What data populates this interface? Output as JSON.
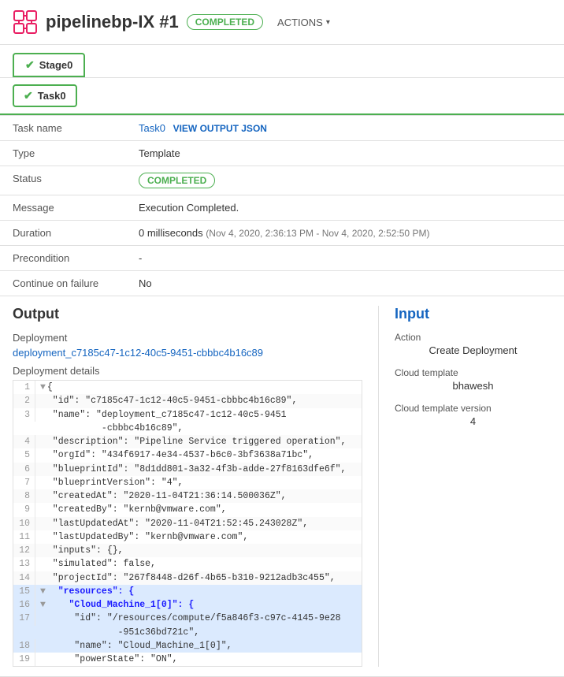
{
  "header": {
    "icon_alt": "pipeline-icon",
    "title": "pipelinebp-IX #1",
    "badge": "COMPLETED",
    "actions_label": "ACTIONS"
  },
  "stage": {
    "label": "Stage0",
    "check": "✔"
  },
  "task": {
    "label": "Task0",
    "check": "✔"
  },
  "info": {
    "task_name_label": "Task name",
    "task_name_value": "Task0",
    "view_output_label": "VIEW OUTPUT JSON",
    "type_label": "Type",
    "type_value": "Template",
    "status_label": "Status",
    "status_value": "COMPLETED",
    "message_label": "Message",
    "message_value": "Execution Completed.",
    "duration_label": "Duration",
    "duration_main": "0 milliseconds",
    "duration_detail": "(Nov 4, 2020, 2:36:13 PM - Nov 4, 2020, 2:52:50 PM)",
    "precondition_label": "Precondition",
    "precondition_value": "-",
    "continue_label": "Continue on failure",
    "continue_value": "No"
  },
  "output": {
    "title": "Output",
    "deployment_label": "Deployment",
    "deployment_link": "deployment_c7185c47-1c12-40c5-9451-cbbbc4b16c89",
    "details_label": "Deployment details",
    "code_lines": [
      {
        "num": "1",
        "arrow": "▼",
        "content": "{",
        "highlight": false
      },
      {
        "num": "2",
        "arrow": " ",
        "content": "  \"id\": \"c7185c47-1c12-40c5-9451-cbbbc4b16c89\",",
        "highlight": false
      },
      {
        "num": "3",
        "arrow": " ",
        "content": "  \"name\": \"deployment_c7185c47-1c12-40c5-9451\n             -cbbbc4b16c89\",",
        "highlight": false
      },
      {
        "num": "4",
        "arrow": " ",
        "content": "  \"description\": \"Pipeline Service triggered operation\",",
        "highlight": false
      },
      {
        "num": "5",
        "arrow": " ",
        "content": "  \"orgId\": \"434f6917-4e34-4537-b6c0-3bf3638a71bc\",",
        "highlight": false
      },
      {
        "num": "6",
        "arrow": " ",
        "content": "  \"blueprintId\": \"8d1dd801-3a32-4f3b-adde-27f8163dfe6f\",",
        "highlight": false
      },
      {
        "num": "7",
        "arrow": " ",
        "content": "  \"blueprintVersion\": \"4\",",
        "highlight": false
      },
      {
        "num": "8",
        "arrow": " ",
        "content": "  \"createdAt\": \"2020-11-04T21:36:14.500036Z\",",
        "highlight": false
      },
      {
        "num": "9",
        "arrow": " ",
        "content": "  \"createdBy\": \"kernb@vmware.com\",",
        "highlight": false
      },
      {
        "num": "10",
        "arrow": " ",
        "content": "  \"lastUpdatedAt\": \"2020-11-04T21:52:45.243028Z\",",
        "highlight": false
      },
      {
        "num": "11",
        "arrow": " ",
        "content": "  \"lastUpdatedBy\": \"kernb@vmware.com\",",
        "highlight": false
      },
      {
        "num": "12",
        "arrow": " ",
        "content": "  \"inputs\": {},",
        "highlight": false
      },
      {
        "num": "13",
        "arrow": " ",
        "content": "  \"simulated\": false,",
        "highlight": false
      },
      {
        "num": "14",
        "arrow": " ",
        "content": "  \"projectId\": \"267f8448-d26f-4b65-b310-9212adb3c455\",",
        "highlight": false
      },
      {
        "num": "15",
        "arrow": "▼",
        "content": "  \"resources\": {",
        "highlight": true,
        "key_highlight": true
      },
      {
        "num": "16",
        "arrow": "▼",
        "content": "    \"Cloud_Machine_1[0]\": {",
        "highlight": true,
        "key_highlight": true
      },
      {
        "num": "17",
        "arrow": " ",
        "content": "      \"id\": \"/resources/compute/f5a846f3-c97c-4145-9e28\n              -951c36bd721c\",",
        "highlight": true
      },
      {
        "num": "18",
        "arrow": " ",
        "content": "      \"name\": \"Cloud_Machine_1[0]\",",
        "highlight": true
      },
      {
        "num": "19",
        "arrow": " ",
        "content": "      \"powerState\": \"ON\",",
        "highlight": false
      }
    ]
  },
  "input": {
    "title": "Input",
    "action_label": "Action",
    "action_value": "Create Deployment",
    "cloud_template_label": "Cloud template",
    "cloud_template_value": "bhawesh",
    "cloud_template_version_label": "Cloud template version",
    "cloud_template_version_value": "4"
  },
  "colors": {
    "completed_green": "#4caf50",
    "link_blue": "#1565c0",
    "highlight_blue": "#dbeafe"
  }
}
